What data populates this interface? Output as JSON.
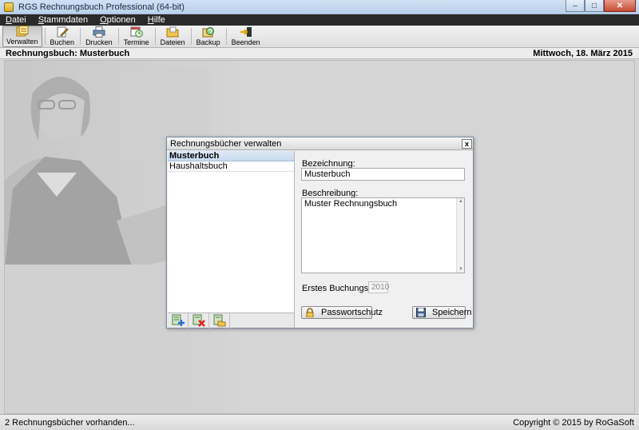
{
  "window": {
    "title": "RGS Rechnungsbuch Professional (64-bit)",
    "buttons": {
      "minimize": "–",
      "maximize": "□",
      "close": "✕"
    }
  },
  "menu": [
    {
      "label": "Datei",
      "underline": "D"
    },
    {
      "label": "Stammdaten",
      "underline": "S"
    },
    {
      "label": "Optionen",
      "underline": "O"
    },
    {
      "label": "Hilfe",
      "underline": "H"
    }
  ],
  "toolbar": {
    "items": [
      {
        "label": "Verwalten",
        "icon": "ledger-icon",
        "active": true
      },
      {
        "label": "Buchen",
        "icon": "pen-icon"
      },
      {
        "label": "Drucken",
        "icon": "printer-icon"
      },
      {
        "label": "Termine",
        "icon": "calendar-clock-icon"
      },
      {
        "label": "Dateien",
        "icon": "folder-icon"
      },
      {
        "label": "Backup",
        "icon": "backup-icon"
      },
      {
        "label": "Beenden",
        "icon": "exit-icon"
      }
    ]
  },
  "header": {
    "book_title": "Rechnungsbuch: Musterbuch",
    "date": "Mittwoch, 18. März 2015"
  },
  "dialog": {
    "title": "Rechnungsbücher verwalten",
    "close_label": "x",
    "list": [
      {
        "label": "Musterbuch",
        "selected": true
      },
      {
        "label": "Haushaltsbuch",
        "selected": false
      }
    ],
    "footer_icons": [
      "add-book-icon",
      "delete-book-icon",
      "open-book-icon"
    ],
    "bezeichnung_label": "Bezeichnung:",
    "bezeichnung_value": "Musterbuch",
    "beschreibung_label": "Beschreibung:",
    "beschreibung_value": "Muster Rechnungsbuch",
    "buchungsjahr_label": "Erstes Buchungsjahr:",
    "buchungsjahr_value": "2010",
    "passwort_label": "Passwortschutz",
    "speichern_label": "Speichern"
  },
  "status": {
    "left": "2 Rechnungsbücher vorhanden...",
    "right": "Copyright © 2015 by RoGaSoft"
  },
  "colors": {
    "accent": "#c9daef",
    "menubar": "#2a2a2a",
    "background": "#d5d5d5"
  }
}
